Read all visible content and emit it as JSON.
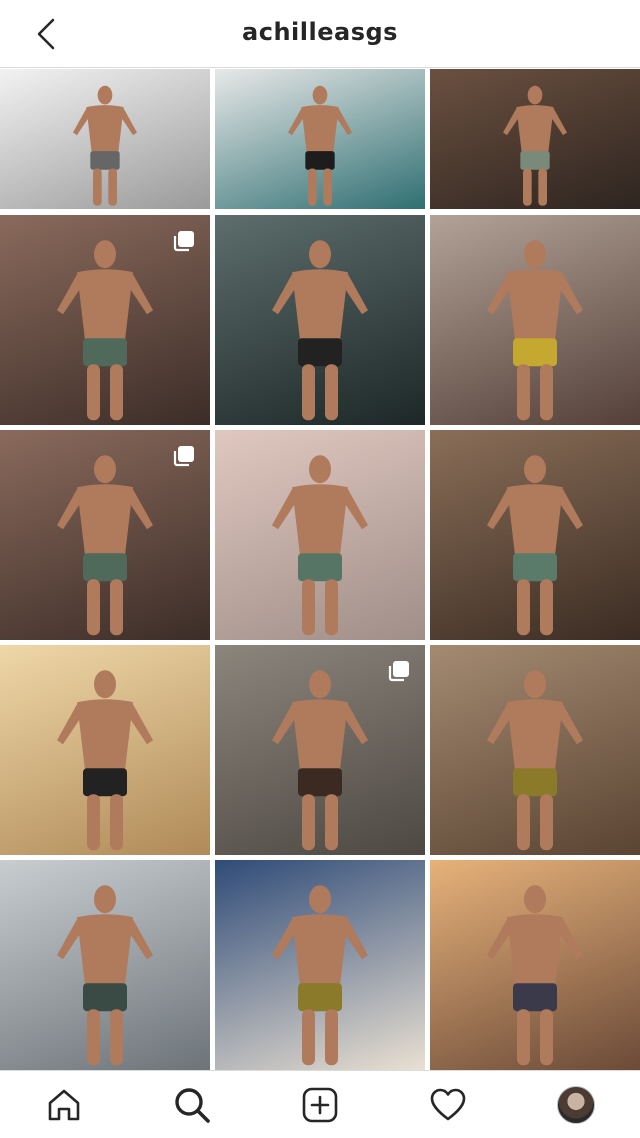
{
  "header": {
    "title": "achilleasgs",
    "back_icon": "chevron-left-icon"
  },
  "grid": {
    "tiles": [
      {
        "name": "post-1",
        "multi": false,
        "palette": [
          "#f2f2f2",
          "#9a9a9a"
        ],
        "subject": "torso-bw"
      },
      {
        "name": "post-2",
        "multi": false,
        "palette": [
          "#e8e8e8",
          "#2f6f72"
        ],
        "subject": "boat"
      },
      {
        "name": "post-3",
        "multi": false,
        "palette": [
          "#6b5040",
          "#2e2520"
        ],
        "subject": "rocks-shirt"
      },
      {
        "name": "post-4",
        "multi": true,
        "palette": [
          "#8a6a5c",
          "#3c2d28"
        ],
        "subject": "beach-flex"
      },
      {
        "name": "post-5",
        "multi": false,
        "palette": [
          "#5d6e6c",
          "#1d2727"
        ],
        "subject": "rain-portrait"
      },
      {
        "name": "post-6",
        "multi": false,
        "palette": [
          "#b2a297",
          "#544039"
        ],
        "subject": "beach-standing"
      },
      {
        "name": "post-7",
        "multi": true,
        "palette": [
          "#8a6a5c",
          "#3c2d28"
        ],
        "subject": "beach-flex"
      },
      {
        "name": "post-8",
        "multi": false,
        "palette": [
          "#e0c8c0",
          "#a08e88"
        ],
        "subject": "beach-pose"
      },
      {
        "name": "post-9",
        "multi": false,
        "palette": [
          "#8a6e58",
          "#3b2c23"
        ],
        "subject": "rocks-bands"
      },
      {
        "name": "post-10",
        "multi": false,
        "palette": [
          "#efd7a8",
          "#b08a58"
        ],
        "subject": "sunset-sea"
      },
      {
        "name": "post-11",
        "multi": true,
        "palette": [
          "#8b857c",
          "#4e4843"
        ],
        "subject": "gym-shirtless"
      },
      {
        "name": "post-12",
        "multi": false,
        "palette": [
          "#a48a72",
          "#5a4432"
        ],
        "subject": "hill-flex"
      },
      {
        "name": "post-13",
        "multi": false,
        "palette": [
          "#c8cdd0",
          "#6d7479"
        ],
        "subject": "white-shirt"
      },
      {
        "name": "post-14",
        "multi": false,
        "palette": [
          "#2f4b78",
          "#e9e0d2"
        ],
        "subject": "earth-atlas"
      },
      {
        "name": "post-15",
        "multi": false,
        "palette": [
          "#e7b27a",
          "#6b4a38"
        ],
        "subject": "water-sunset"
      }
    ]
  },
  "tabbar": {
    "home_icon": "home-icon",
    "search_icon": "search-icon",
    "add_icon": "add-post-icon",
    "activity_icon": "heart-icon",
    "profile_icon": "profile-avatar"
  }
}
